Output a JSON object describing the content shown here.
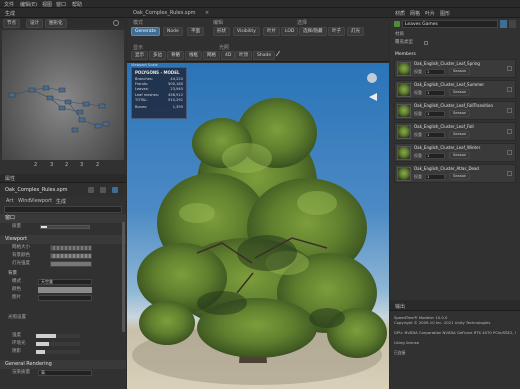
{
  "top_menu": [
    "文件",
    "编辑(E)",
    "视图",
    "窗口",
    "帮助"
  ],
  "left_top": {
    "tab": "生成",
    "toolbar": [
      "节点",
      "设计",
      "图形化"
    ],
    "counts": [
      "2",
      "3",
      "2",
      "3",
      "2"
    ]
  },
  "properties": {
    "tab": "属性",
    "filename": "Oak_Complex_Rules.spm",
    "subtabs": [
      "Art",
      "Wind",
      "Viewport",
      "生成"
    ],
    "sec1": "窗口",
    "sec1_row": "质量",
    "viewport_title": "Viewport",
    "viewport_rows": [
      "网格大小",
      "背景颜色",
      "灯光强度"
    ],
    "groups": [
      "背景",
      "天空盒",
      "地面"
    ],
    "group_rows": [
      "模式",
      "颜色",
      "图片"
    ],
    "mode_value": "天空盒",
    "sub_label": "光照设置",
    "light_rows": [
      "强度",
      "环境光",
      "阴影"
    ],
    "general_title": "General Rendering",
    "general_row": "渲染质量",
    "general_value": "高"
  },
  "center": {
    "tab": "Oak_Complex_Rules.spm",
    "toolbar_left_label": "模式",
    "toolbar_mid_label": "编辑",
    "toolbar_right_label": "选择",
    "row1": [
      "Generate",
      "Node",
      "平面"
    ],
    "row1b": [
      "形状",
      "Visibility",
      "叶片",
      "LOD"
    ],
    "row1c": [
      "选择/隐藏",
      "叶子",
      "灯光"
    ],
    "row2_label": "显示",
    "row2": [
      "显示",
      "多边",
      "骨骼",
      "线框",
      "网格"
    ],
    "row2_label2": "光照",
    "row2b": [
      "4D",
      "叶顶",
      "Shade"
    ],
    "stats": {
      "title": "POLYGONS - MODEL",
      "rows": [
        [
          "Branches:",
          "44,220"
        ],
        [
          "Fronds:",
          "500,160"
        ],
        [
          "Leaves:",
          "23,945"
        ],
        [
          "Leaf meshes:",
          "458,912"
        ],
        [
          "TOTAL:",
          "910,291"
        ]
      ],
      "bones_label": "Bones:",
      "bones_value": "1,395",
      "scale_label": "Viewport Scale"
    }
  },
  "right": {
    "tabs": [
      "材质",
      "网格",
      "叶片",
      "图形"
    ],
    "asset": "Leaves Games",
    "prop_labels": [
      "材质",
      "覆盖类型"
    ],
    "members_label": "Members",
    "members": [
      {
        "name": "Oak_English_Cluster_Leaf_Spring",
        "value": "1",
        "season": "Season"
      },
      {
        "name": "Oak_English_Cluster_Leaf_Summer",
        "value": "1",
        "season": "Season"
      },
      {
        "name": "Oak_English_Cluster_Leaf_FallTransition",
        "value": "1",
        "season": "Season"
      },
      {
        "name": "Oak_English_Cluster_Leaf_Fall",
        "value": "1",
        "season": "Season"
      },
      {
        "name": "Oak_English_Cluster_Leaf_Winter",
        "value": "1",
        "season": "Season"
      },
      {
        "name": "Oak_English_Cluster_Atlas_Dead",
        "value": "1",
        "season": "Season"
      }
    ],
    "member_field_label": "权重"
  },
  "output": {
    "tab": "输出",
    "lines": [
      "SpeedTree® Modeler 10.0.0",
      "Copyright © 2009-10 Inc. 2021 Unity Technologies",
      "",
      "GPU: NVIDIA Corporation NVIDIA GeForce RTX 4070 PCIe/SSE2, OpenGL 4.5.0",
      "",
      "Using license",
      "",
      "已连接"
    ]
  }
}
